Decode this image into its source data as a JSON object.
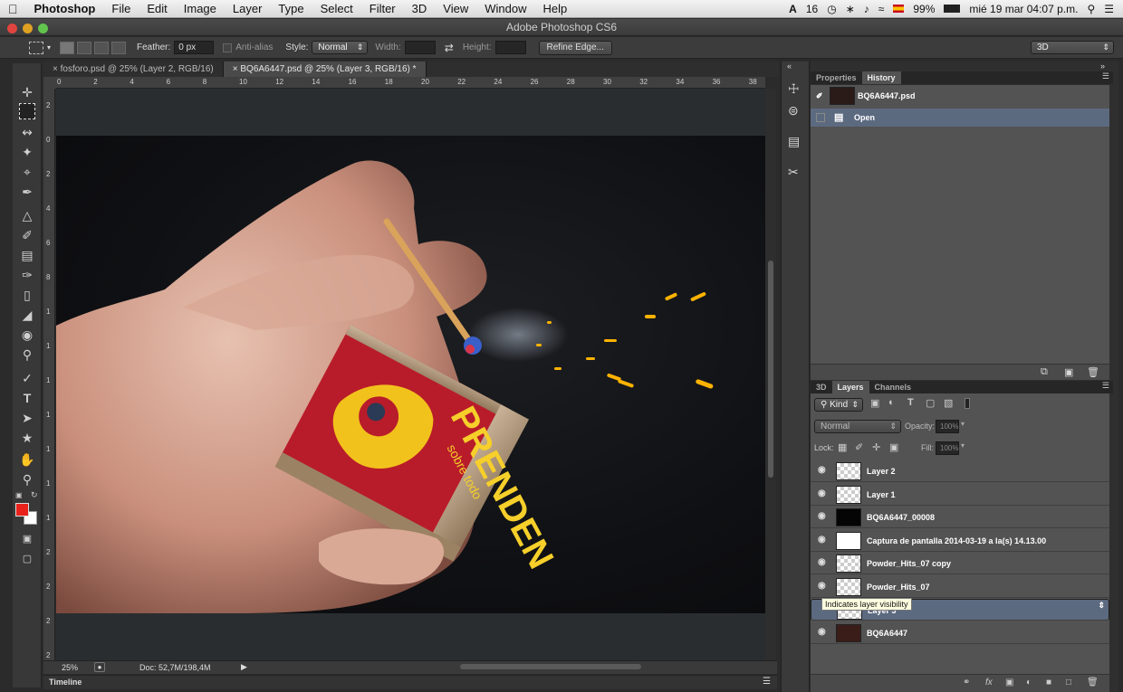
{
  "menubar": {
    "apple": "",
    "app": "Photoshop",
    "items": [
      "File",
      "Edit",
      "Image",
      "Layer",
      "Type",
      "Select",
      "Filter",
      "3D",
      "View",
      "Window",
      "Help"
    ],
    "adobe_badge": "16",
    "battery": "99%",
    "clock": "mié 19 mar  04:07 p.m."
  },
  "titlebar": {
    "title": "Adobe Photoshop CS6"
  },
  "options": {
    "feather_label": "Feather:",
    "feather_value": "0 px",
    "antialias_label": "Anti-alias",
    "style_label": "Style:",
    "style_value": "Normal",
    "width_label": "Width:",
    "height_label": "Height:",
    "refine_label": "Refine Edge...",
    "workspace": "3D"
  },
  "doc_tabs": [
    {
      "label": "fosforo.psd @ 25% (Layer 2, RGB/16)"
    },
    {
      "label": "BQ6A6447.psd @ 25% (Layer 3, RGB/16) *"
    }
  ],
  "ruler_h": [
    "0",
    "2",
    "4",
    "6",
    "8",
    "10",
    "12",
    "14",
    "16",
    "18",
    "20",
    "22",
    "24",
    "26",
    "28",
    "30",
    "32",
    "34",
    "36",
    "38"
  ],
  "ruler_v": [
    "2",
    "0",
    "2",
    "4",
    "6",
    "8",
    "1",
    "1",
    "1",
    "1",
    "1",
    "1",
    "1",
    "2",
    "2",
    "2",
    "2"
  ],
  "status": {
    "zoom": "25%",
    "doc": "Doc: 52,7M/198,4M"
  },
  "timeline": {
    "label": "Timeline"
  },
  "photo": {
    "box_text": "PRENDEN",
    "box_subtext": "sobre todo"
  },
  "top_panel": {
    "tabs": [
      "Properties",
      "History"
    ],
    "snapshot": "BQ6A6447.psd",
    "states": [
      "Open"
    ]
  },
  "layers_panel": {
    "tabs": [
      "3D",
      "Layers",
      "Channels"
    ],
    "kind_label": "Kind",
    "blend_mode": "Normal",
    "opacity_label": "Opacity:",
    "opacity_value": "100%",
    "lock_label": "Lock:",
    "fill_label": "Fill:",
    "fill_value": "100%",
    "layers": [
      {
        "name": "Layer 2"
      },
      {
        "name": "Layer 1"
      },
      {
        "name": "BQ6A6447_00008"
      },
      {
        "name": "Captura de pantalla 2014-03-19 a la(s) 14.13.00"
      },
      {
        "name": "Powder_Hits_07 copy"
      },
      {
        "name": "Powder_Hits_07"
      },
      {
        "name": "Layer 3"
      },
      {
        "name": "BQ6A6447"
      }
    ],
    "tooltip": "Indicates layer visibility",
    "footer_icons": [
      "link-icon",
      "fx",
      "mask-icon",
      "adjustment-icon",
      "group-icon",
      "new-layer-icon",
      "trash-icon"
    ]
  }
}
